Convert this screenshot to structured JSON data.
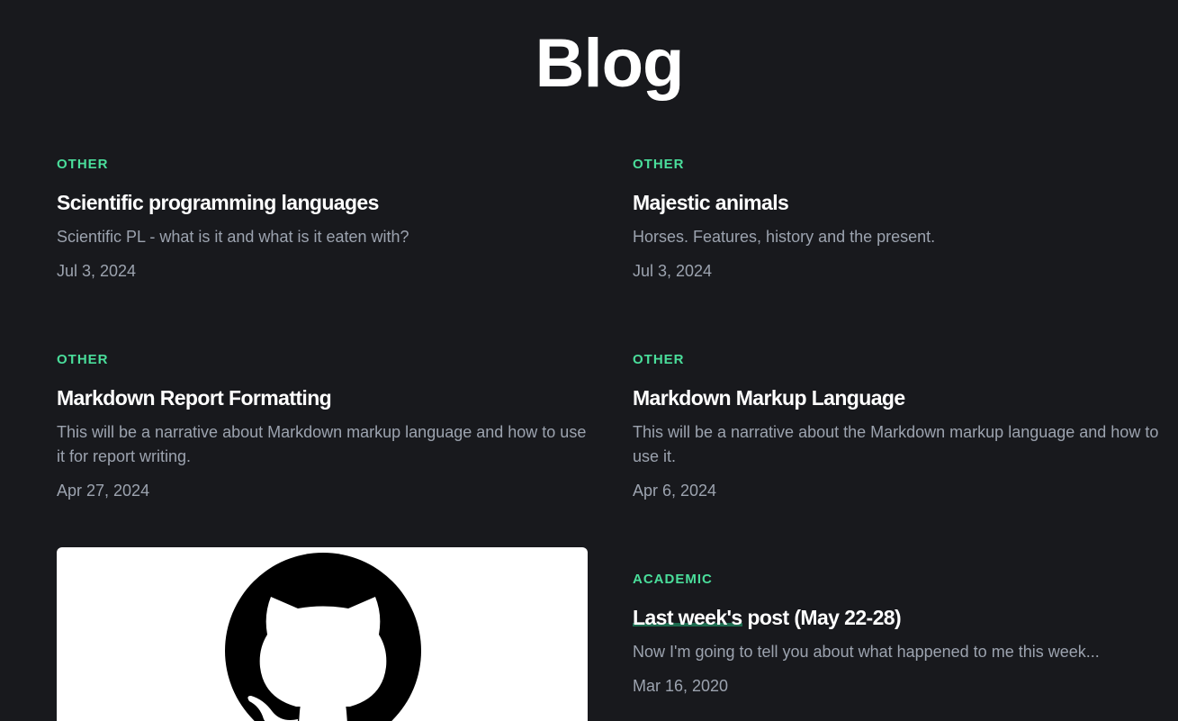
{
  "page": {
    "title": "Blog"
  },
  "posts": [
    {
      "category": "OTHER",
      "title": "Scientific programming languages",
      "description": "Scientific PL - what is it and what is it eaten with?",
      "date": "Jul 3, 2024"
    },
    {
      "category": "OTHER",
      "title": "Majestic animals",
      "description": "Horses. Features, history and the present.",
      "date": "Jul 3, 2024"
    },
    {
      "category": "OTHER",
      "title": "Markdown Report Formatting",
      "description": "This will be a narrative about Markdown markup language and how to use it for report writing.",
      "date": "Apr 27, 2024"
    },
    {
      "category": "OTHER",
      "title": "Markdown Markup Language",
      "description": "This will be a narrative about the Markdown markup language and how to use it.",
      "date": "Apr 6, 2024"
    },
    {
      "category": "ACADEMIC",
      "title_highlight": "Last week's",
      "title_rest": " post (May 22-28)",
      "description": "Now I'm going to tell you about what happened to me this week...",
      "date": "Mar 16, 2020"
    }
  ],
  "image_card": {
    "icon": "github-icon",
    "background": "#ffffff"
  },
  "colors": {
    "background": "#18191d",
    "accent": "#4ade9b",
    "title": "#ffffff",
    "muted": "#9ca3af",
    "highlight": "#1d6b4f"
  }
}
